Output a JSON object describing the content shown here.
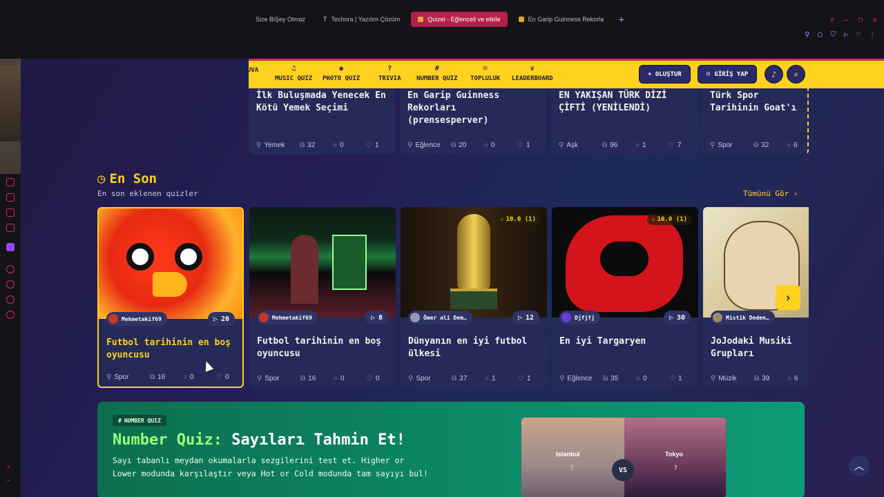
{
  "browser": {
    "tabs": [
      {
        "label": "Size BiŞey Olmaz",
        "active": false
      },
      {
        "label": "Techora | Yazılım Çözüm",
        "active": false
      },
      {
        "label": "Quizei - Eğlenceli ve etkile",
        "active": true
      },
      {
        "label": "En Garip Guinness Rekorla",
        "active": false
      }
    ],
    "new_tab": "+"
  },
  "nav": {
    "items": [
      {
        "label": "UVA",
        "icon": ""
      },
      {
        "label": "MUSIC QUIZ",
        "icon": "♫"
      },
      {
        "label": "PHOTO QUIZ",
        "icon": "◉"
      },
      {
        "label": "TRIVIA",
        "icon": "?"
      },
      {
        "label": "NUMBER QUIZ",
        "icon": "#"
      },
      {
        "label": "TOPLULUK",
        "icon": "☺"
      },
      {
        "label": "LEADERBOARD",
        "icon": "♛"
      }
    ],
    "create_label": "+ OLUŞTUR",
    "login_label": "GİRİŞ YAP"
  },
  "top_cards": [
    {
      "title": "İlk Buluşmada Yenecek En Kötü Yemek Seçimi",
      "category": "Yemek",
      "questions": "32",
      "comments": "0",
      "likes": "1"
    },
    {
      "title": "En Garip Guinness Rekorları (prensesperver)",
      "category": "Eğlence",
      "questions": "20",
      "comments": "0",
      "likes": "1"
    },
    {
      "title": "EN YAKIŞAN TÜRK DİZİ ÇİFTİ (YENİLENDİ)",
      "category": "Aşk",
      "questions": "96",
      "comments": "1",
      "likes": "7"
    },
    {
      "title": "Türk Spor Tarihinin Goat'ı",
      "category": "Spor",
      "questions": "32",
      "comments": "6",
      "likes": ""
    }
  ],
  "latest": {
    "title": "En Son",
    "subtitle": "En son eklenen quizler",
    "see_all": "Tümünü Gör ›",
    "cards": [
      {
        "title": "Futbol tarihinin en boş oyuncusu",
        "author": "Mehmetakif69",
        "plays": "20",
        "rating": "",
        "category": "Spor",
        "questions": "16",
        "comments": "0",
        "likes": "0",
        "highlighted": true
      },
      {
        "title": "Futbol tarihinin en boş oyuncusu",
        "author": "Mehmetakif69",
        "plays": "8",
        "rating": "",
        "category": "Spor",
        "questions": "16",
        "comments": "0",
        "likes": "0",
        "highlighted": false
      },
      {
        "title": "Dünyanın en iyi futbol ülkesi",
        "author": "Ömer ali Dem…",
        "plays": "12",
        "rating": "10.0 (1)",
        "category": "Spor",
        "questions": "37",
        "comments": "1",
        "likes": "1",
        "highlighted": false
      },
      {
        "title": "En iyi Targaryen",
        "author": "Djfjfj",
        "plays": "30",
        "rating": "10.0 (1)",
        "category": "Eğlence",
        "questions": "35",
        "comments": "0",
        "likes": "1",
        "highlighted": false
      },
      {
        "title": "JoJodaki Musiki Grupları",
        "author": "Mistik Deden…",
        "plays": "",
        "rating": "",
        "category": "Müzik",
        "questions": "39",
        "comments": "6",
        "likes": "",
        "highlighted": false
      }
    ]
  },
  "promo": {
    "tag": "NUMBER QUIZ",
    "title_accent": "Number Quiz:",
    "title_rest": "Sayıları Tahmin Et!",
    "description": "Sayı tabanlı meydan okumalarla sezgilerini test et. Higher or Lower modunda karşılaştır veya Hot or Cold modunda tam sayıyı bul!",
    "city_left": "Istanbul",
    "city_right": "Tokyo",
    "q": "?",
    "vs": "VS"
  },
  "colors": {
    "accent": "#ffd21f",
    "brand_bg": "#241f57",
    "promo": "#0c8a66"
  }
}
